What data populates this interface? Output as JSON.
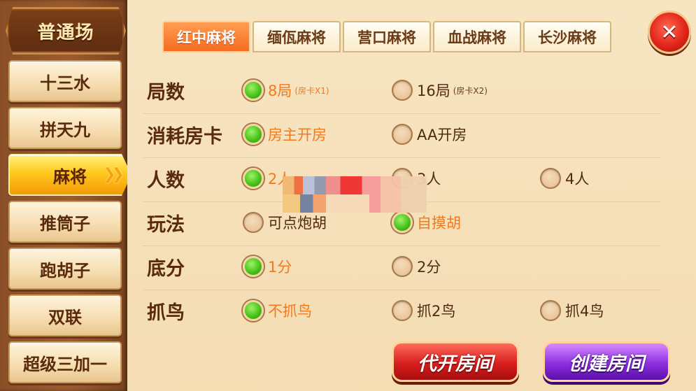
{
  "sidebar": {
    "header": "普通场",
    "items": [
      {
        "label": "十三水",
        "active": false
      },
      {
        "label": "拼天九",
        "active": false
      },
      {
        "label": "麻将",
        "active": true
      },
      {
        "label": "推筒子",
        "active": false
      },
      {
        "label": "跑胡子",
        "active": false
      },
      {
        "label": "双联",
        "active": false
      },
      {
        "label": "超级三加一",
        "active": false
      }
    ]
  },
  "tabs": [
    {
      "label": "红中麻将",
      "active": true
    },
    {
      "label": "缅佤麻将",
      "active": false
    },
    {
      "label": "营口麻将",
      "active": false
    },
    {
      "label": "血战麻将",
      "active": false
    },
    {
      "label": "长沙麻将",
      "active": false
    }
  ],
  "options": {
    "rounds": {
      "label": "局数",
      "choices": [
        {
          "text": "8局",
          "sub": "(房卡X1)",
          "selected": true
        },
        {
          "text": "16局",
          "sub": "(房卡X2)",
          "selected": false
        }
      ]
    },
    "card_cost": {
      "label": "消耗房卡",
      "choices": [
        {
          "text": "房主开房",
          "selected": true
        },
        {
          "text": "AA开房",
          "selected": false
        }
      ]
    },
    "players": {
      "label": "人数",
      "choices": [
        {
          "text": "2人",
          "selected": true
        },
        {
          "text": "3人",
          "selected": false
        },
        {
          "text": "4人",
          "selected": false
        }
      ]
    },
    "rules": {
      "label": "玩法",
      "choices": [
        {
          "text": "可点炮胡",
          "selected": false
        },
        {
          "text": "自摸胡",
          "selected": true
        }
      ]
    },
    "base_score": {
      "label": "底分",
      "choices": [
        {
          "text": "1分",
          "selected": true
        },
        {
          "text": "2分",
          "selected": false
        }
      ]
    },
    "birds": {
      "label": "抓鸟",
      "choices": [
        {
          "text": "不抓鸟",
          "selected": true
        },
        {
          "text": "抓2鸟",
          "selected": false
        },
        {
          "text": "抓4鸟",
          "selected": false
        }
      ]
    }
  },
  "buttons": {
    "proxy_open": "代开房间",
    "create_room": "创建房间",
    "close_symbol": "✕"
  },
  "colors": {
    "selected_text": "#f07a1d",
    "active_tab": "#f56c22",
    "active_nav": "#ffc81e"
  }
}
